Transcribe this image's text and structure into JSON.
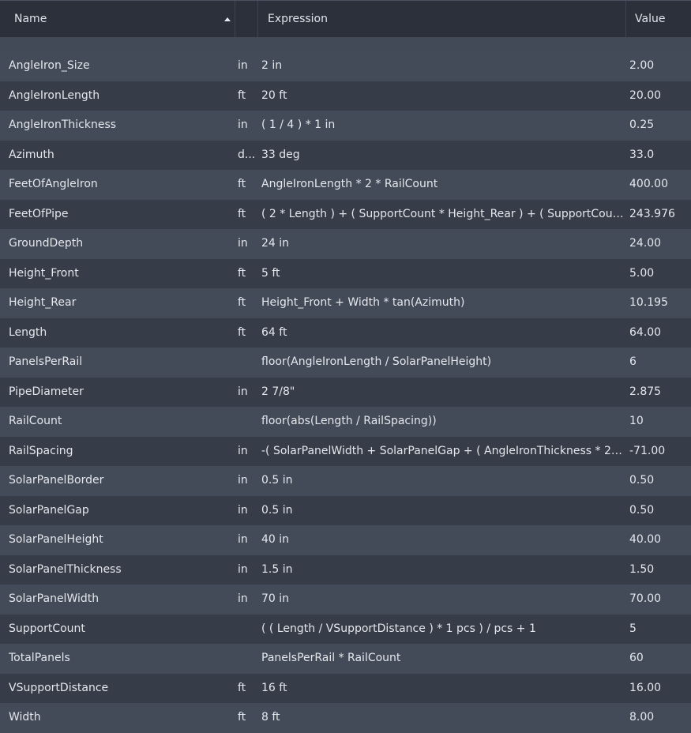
{
  "header": {
    "name_label": "Name",
    "expression_label": "Expression",
    "value_label": "Value",
    "sort_icon": "sort-ascending-icon"
  },
  "rows": [
    {
      "name": "AngleIron_Size",
      "unit": "in",
      "expression": "2 in",
      "value": "2.00"
    },
    {
      "name": "AngleIronLength",
      "unit": "ft",
      "expression": "20 ft",
      "value": "20.00"
    },
    {
      "name": "AngleIronThickness",
      "unit": "in",
      "expression": "( 1 / 4 ) * 1 in",
      "value": "0.25"
    },
    {
      "name": "Azimuth",
      "unit": "d...",
      "expression": "33 deg",
      "value": "33.0"
    },
    {
      "name": "FeetOfAngleIron",
      "unit": "ft",
      "expression": "AngleIronLength * 2 * RailCount",
      "value": "400.00"
    },
    {
      "name": "FeetOfPipe",
      "unit": "ft",
      "expression": "( 2 * Length ) + ( SupportCount * Height_Rear ) + ( SupportCoun...",
      "value": "243.976"
    },
    {
      "name": "GroundDepth",
      "unit": "in",
      "expression": "24 in",
      "value": "24.00"
    },
    {
      "name": "Height_Front",
      "unit": "ft",
      "expression": "5 ft",
      "value": "5.00"
    },
    {
      "name": "Height_Rear",
      "unit": "ft",
      "expression": "Height_Front + Width * tan(Azimuth)",
      "value": "10.195"
    },
    {
      "name": "Length",
      "unit": "ft",
      "expression": "64 ft",
      "value": "64.00"
    },
    {
      "name": "PanelsPerRail",
      "unit": "",
      "expression": "floor(AngleIronLength / SolarPanelHeight)",
      "value": "6"
    },
    {
      "name": "PipeDiameter",
      "unit": "in",
      "expression": "2 7/8\"",
      "value": "2.875"
    },
    {
      "name": "RailCount",
      "unit": "",
      "expression": "floor(abs(Length / RailSpacing))",
      "value": "10"
    },
    {
      "name": "RailSpacing",
      "unit": "in",
      "expression": "-( SolarPanelWidth + SolarPanelGap + ( AngleIronThickness * 2 ...",
      "value": "-71.00"
    },
    {
      "name": "SolarPanelBorder",
      "unit": "in",
      "expression": "0.5 in",
      "value": "0.50"
    },
    {
      "name": "SolarPanelGap",
      "unit": "in",
      "expression": "0.5 in",
      "value": "0.50"
    },
    {
      "name": "SolarPanelHeight",
      "unit": "in",
      "expression": "40 in",
      "value": "40.00"
    },
    {
      "name": "SolarPanelThickness",
      "unit": "in",
      "expression": "1.5 in",
      "value": "1.50"
    },
    {
      "name": "SolarPanelWidth",
      "unit": "in",
      "expression": "70 in",
      "value": "70.00"
    },
    {
      "name": "SupportCount",
      "unit": "",
      "expression": "( ( Length / VSupportDistance ) * 1 pcs ) / pcs + 1",
      "value": "5"
    },
    {
      "name": "TotalPanels",
      "unit": "",
      "expression": "PanelsPerRail * RailCount",
      "value": "60"
    },
    {
      "name": "VSupportDistance",
      "unit": "ft",
      "expression": "16 ft",
      "value": "16.00"
    },
    {
      "name": "Width",
      "unit": "ft",
      "expression": "8 ft",
      "value": "8.00"
    }
  ]
}
